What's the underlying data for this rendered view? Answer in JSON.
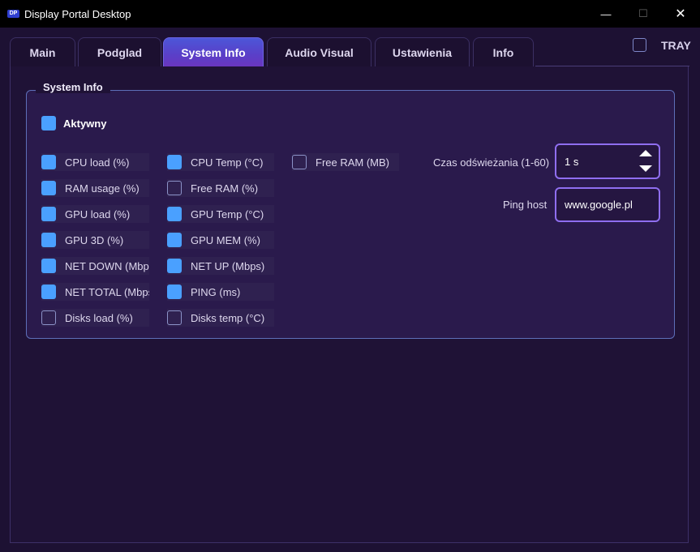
{
  "window": {
    "app_icon": "DP",
    "title": "Display Portal Desktop",
    "minimize_glyph": "—",
    "maximize_glyph": "☐",
    "close_glyph": "✕"
  },
  "tabs": [
    {
      "label": "Main",
      "active": false
    },
    {
      "label": "Podglad",
      "active": false
    },
    {
      "label": "System Info",
      "active": true
    },
    {
      "label": "Audio Visual",
      "active": false
    },
    {
      "label": "Ustawienia",
      "active": false
    },
    {
      "label": "Info",
      "active": false
    }
  ],
  "tray": {
    "label": "TRAY",
    "checked": false
  },
  "group": {
    "title": "System Info",
    "active": {
      "label": "Aktywny",
      "checked": true
    },
    "checkboxes": [
      {
        "label": "CPU load (%)",
        "checked": true
      },
      {
        "label": "RAM usage (%)",
        "checked": true
      },
      {
        "label": "GPU load (%)",
        "checked": true
      },
      {
        "label": "GPU 3D (%)",
        "checked": true
      },
      {
        "label": "NET DOWN (Mbp",
        "checked": true
      },
      {
        "label": "NET TOTAL (Mbps",
        "checked": true
      },
      {
        "label": "Disks load (%)",
        "checked": false
      },
      {
        "label": "CPU Temp (°C)",
        "checked": true
      },
      {
        "label": "Free RAM (%)",
        "checked": false
      },
      {
        "label": "GPU Temp (°C)",
        "checked": true
      },
      {
        "label": "GPU MEM (%)",
        "checked": true
      },
      {
        "label": "NET UP (Mbps)",
        "checked": true
      },
      {
        "label": "PING (ms)",
        "checked": true
      },
      {
        "label": "Disks temp (°C)",
        "checked": false
      },
      {
        "label": "Free RAM (MB)",
        "checked": false
      }
    ],
    "refresh": {
      "label": "Czas odświeżania (1-60)",
      "value": "1 s"
    },
    "ping": {
      "label": "Ping host",
      "value": "www.google.pl"
    }
  },
  "colors": {
    "accent_checked": "#4aa0ff",
    "field_border": "#8f6ef0",
    "active_tab": "#5a3fc8"
  }
}
